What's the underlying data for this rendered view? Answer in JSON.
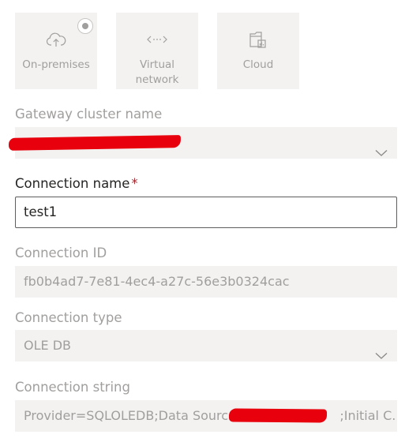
{
  "tiles": [
    {
      "label_lines": [
        "On-premises"
      ],
      "icon": "cloud-upload-icon",
      "selected": true
    },
    {
      "label_lines": [
        "Virtual",
        "network"
      ],
      "icon": "virtual-network-icon",
      "selected": false
    },
    {
      "label_lines": [
        "Cloud"
      ],
      "icon": "cloud-app-icon",
      "selected": false
    }
  ],
  "gateway": {
    "label": "Gateway cluster name",
    "value": ""
  },
  "connection_name": {
    "label": "Connection name",
    "required_marker": "*",
    "value": "test1"
  },
  "connection_id": {
    "label": "Connection ID",
    "value": "fb0b4ad7-7e81-4ec4-a27c-56e3b0324cac"
  },
  "connection_type": {
    "label": "Connection type",
    "value": "OLE DB"
  },
  "connection_string": {
    "label": "Connection string",
    "value_prefix": "Provider=SQLOLEDB;Data Source=",
    "value_suffix": ";Initial C..."
  },
  "colors": {
    "accent_required": "#a4262c",
    "redaction": "#e8000d",
    "disabled_text": "#a19f9d",
    "disabled_fill": "#f3f2f1"
  }
}
